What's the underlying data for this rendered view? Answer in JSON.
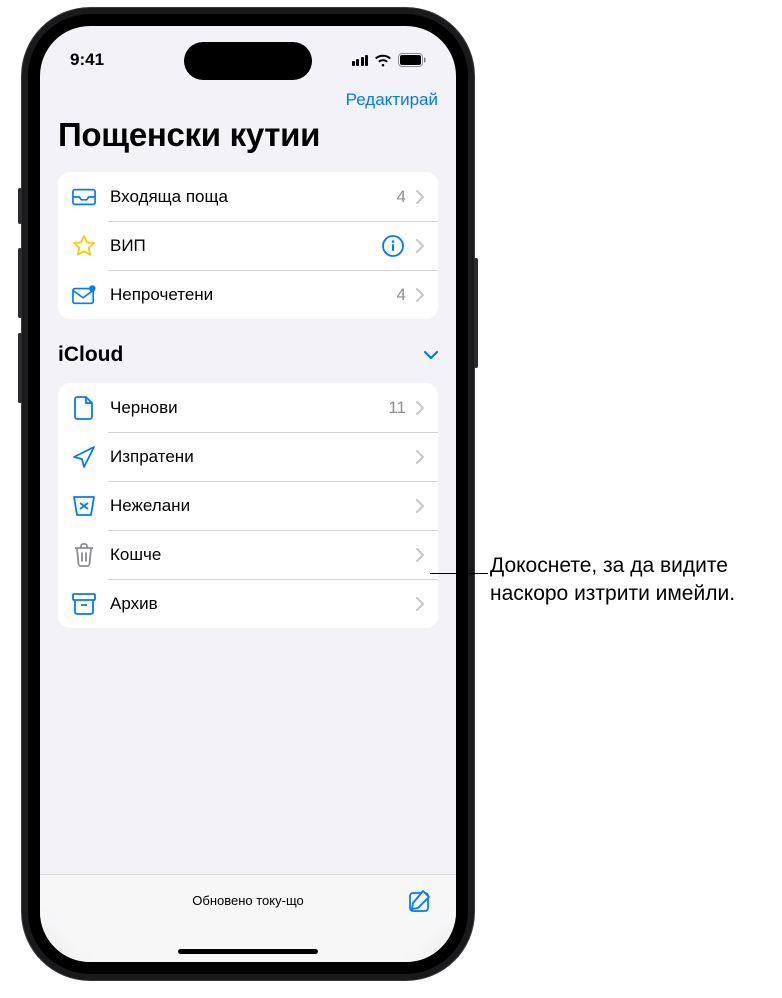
{
  "statusBar": {
    "time": "9:41"
  },
  "nav": {
    "edit": "Редактирай"
  },
  "title": "Пощенски кутии",
  "mainGroup": [
    {
      "icon": "inbox",
      "label": "Входяща поща",
      "badge": "4",
      "info": false
    },
    {
      "icon": "star",
      "label": "ВИП",
      "badge": "",
      "info": true
    },
    {
      "icon": "unread",
      "label": "Непрочетени",
      "badge": "4",
      "info": false
    }
  ],
  "section": {
    "title": "iCloud"
  },
  "icloudGroup": [
    {
      "icon": "draft",
      "label": "Чернови",
      "badge": "11"
    },
    {
      "icon": "sent",
      "label": "Изпратени",
      "badge": ""
    },
    {
      "icon": "junk",
      "label": "Нежелани",
      "badge": ""
    },
    {
      "icon": "trash",
      "label": "Кошче",
      "badge": ""
    },
    {
      "icon": "archive",
      "label": "Архив",
      "badge": ""
    }
  ],
  "toolbar": {
    "status": "Обновено току-що"
  },
  "callout": {
    "text": "Докоснете, за да видите наскоро изтрити имейли."
  },
  "colors": {
    "accent": "#007aff",
    "star": "#ffcc00",
    "gray": "#8e8e93",
    "chevron": "#c7c7cc"
  }
}
